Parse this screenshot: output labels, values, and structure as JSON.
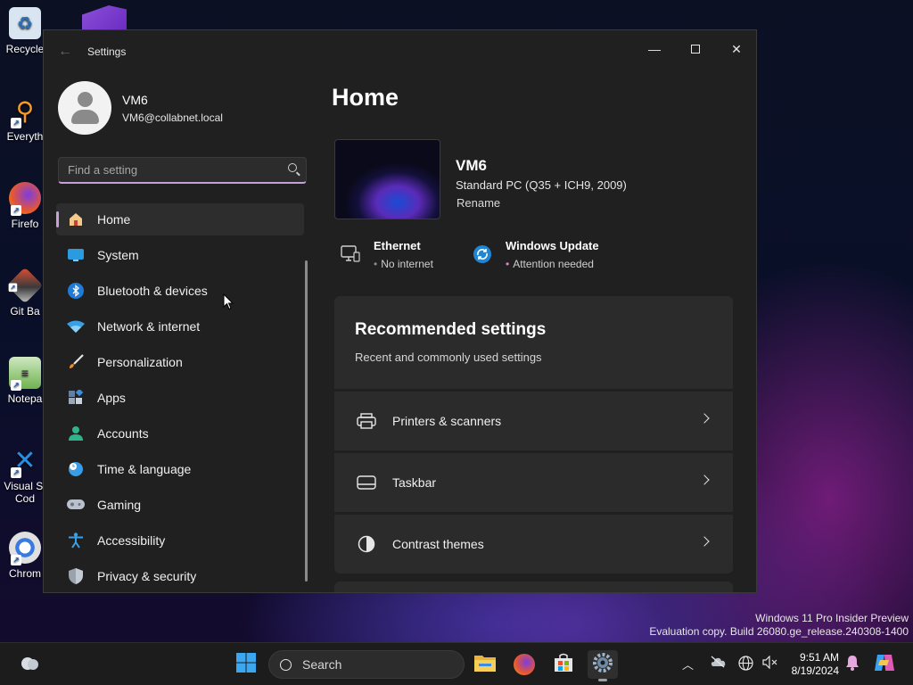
{
  "desktop": {
    "icons": [
      {
        "label": "Recycle",
        "name": "recycle-bin"
      },
      {
        "label": "Everyth",
        "name": "everything"
      },
      {
        "label": "Firefo",
        "name": "firefox"
      },
      {
        "label": "Git Ba",
        "name": "git-bash"
      },
      {
        "label": "Notepa",
        "name": "notepad"
      },
      {
        "label": "Visual St",
        "label2": "Cod",
        "name": "visual-studio-code"
      },
      {
        "label": "Chrom",
        "name": "chrome"
      }
    ]
  },
  "window": {
    "title": "Settings"
  },
  "profile": {
    "name": "VM6",
    "email": "VM6@collabnet.local"
  },
  "search": {
    "placeholder": "Find a setting"
  },
  "nav": {
    "items": [
      {
        "label": "Home",
        "icon": "home-icon",
        "active": true
      },
      {
        "label": "System",
        "icon": "system-icon"
      },
      {
        "label": "Bluetooth & devices",
        "icon": "bluetooth-icon"
      },
      {
        "label": "Network & internet",
        "icon": "wifi-icon"
      },
      {
        "label": "Personalization",
        "icon": "brush-icon"
      },
      {
        "label": "Apps",
        "icon": "apps-icon"
      },
      {
        "label": "Accounts",
        "icon": "person-icon"
      },
      {
        "label": "Time & language",
        "icon": "globe-clock-icon"
      },
      {
        "label": "Gaming",
        "icon": "gamepad-icon"
      },
      {
        "label": "Accessibility",
        "icon": "accessibility-icon"
      },
      {
        "label": "Privacy & security",
        "icon": "shield-icon"
      }
    ]
  },
  "home": {
    "title": "Home",
    "pc_name": "VM6",
    "pc_desc": "Standard PC (Q35 + ICH9, 2009)",
    "rename_label": "Rename",
    "ethernet_title": "Ethernet",
    "ethernet_status": "No internet",
    "update_title": "Windows Update",
    "update_status": "Attention needed",
    "recommended_title": "Recommended settings",
    "recommended_sub": "Recent and commonly used settings",
    "recommended_items": [
      {
        "label": "Printers & scanners",
        "icon": "printer-icon"
      },
      {
        "label": "Taskbar",
        "icon": "taskbar-icon"
      },
      {
        "label": "Contrast themes",
        "icon": "contrast-icon"
      }
    ]
  },
  "watermark": {
    "line1": "Windows 11 Pro Insider Preview",
    "line2": "Evaluation copy. Build 26080.ge_release.240308-1400"
  },
  "taskbar": {
    "search_label": "Search",
    "time": "9:51 AM",
    "date": "8/19/2024"
  },
  "colors": {
    "accent": "#c7a0d8",
    "window_bg": "#202020",
    "card_bg": "#2b2b2b"
  }
}
